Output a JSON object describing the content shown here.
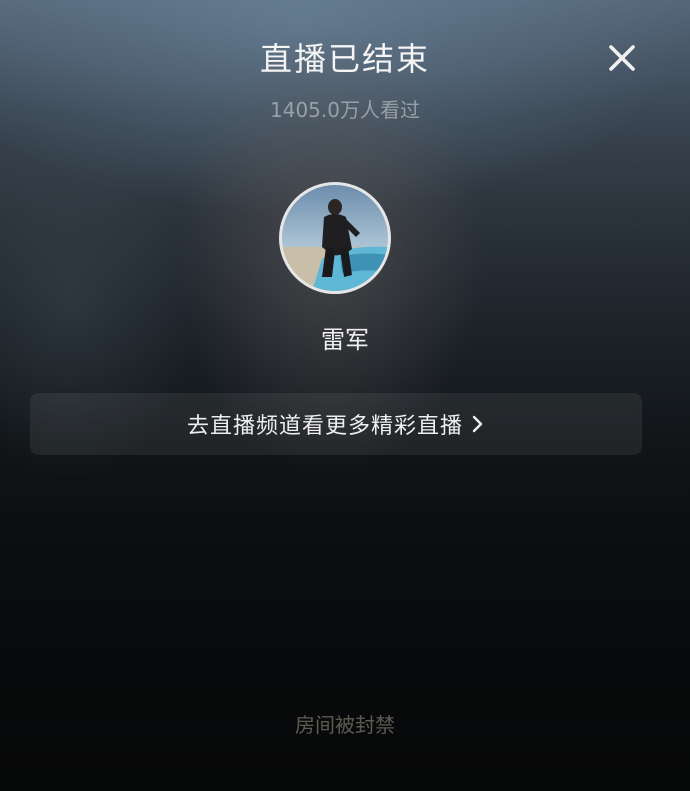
{
  "header": {
    "title": "直播已结束",
    "viewers": "1405.0万人看过",
    "close_icon": "close-icon"
  },
  "streamer": {
    "avatar_icon": "avatar",
    "name": "雷军"
  },
  "channel_link": {
    "label": "去直播频道看更多精彩直播",
    "icon": "chevron-right-icon"
  },
  "footer": {
    "status": "房间被封禁"
  },
  "colors": {
    "title_text": "#f4f4f4",
    "muted_text": "#8a8a8a",
    "button_bg": "#1f2427",
    "background_top": "#55677a",
    "background_bottom": "#070808"
  }
}
